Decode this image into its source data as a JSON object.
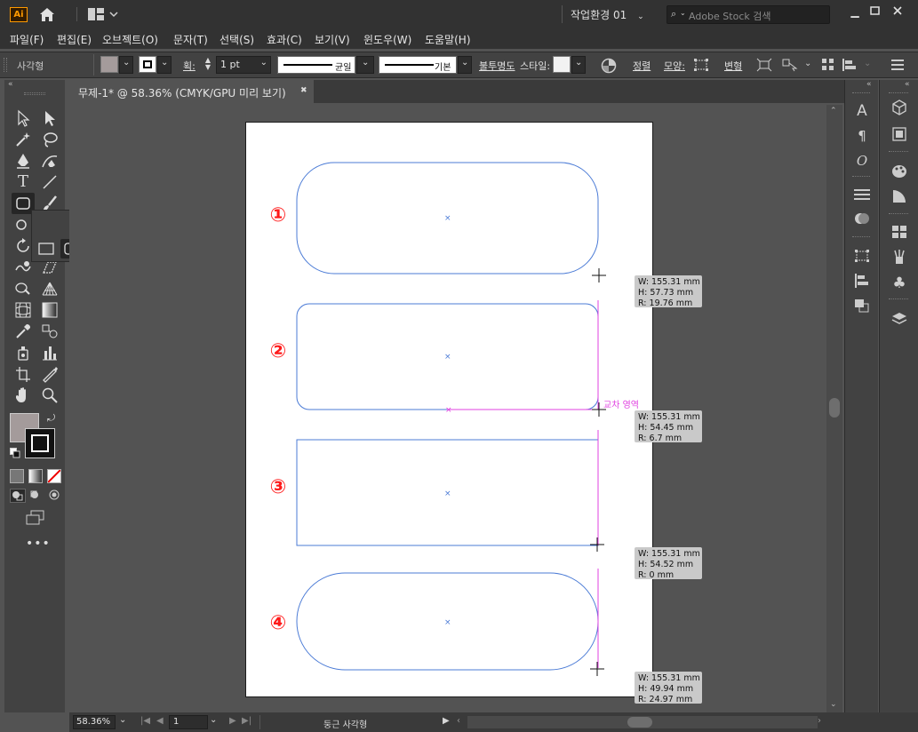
{
  "app": {
    "logo": "Ai",
    "workspace": "작업환경 01",
    "search_placeholder": "Adobe Stock 검색"
  },
  "menu": [
    "파일(F)",
    "편집(E)",
    "오브젝트(O)",
    "문자(T)",
    "선택(S)",
    "효과(C)",
    "보기(V)",
    "윈도우(W)",
    "도움말(H)"
  ],
  "control": {
    "object_type": "사각형",
    "stroke_label": "획:",
    "stroke_weight": "1 pt",
    "profile_label": "균일",
    "brush_label": "기본",
    "opacity_label": "불투명도",
    "style_label": "스타일:",
    "align_label": "정렬",
    "shape_label": "모양:",
    "transform_label": "변형"
  },
  "document": {
    "tab_title": "무제-1* @ 58.36% (CMYK/GPU 미리 보기)",
    "close_glyph": "✖"
  },
  "shapes": [
    {
      "number": "①",
      "w": "W: 155.31 mm",
      "h": "H: 57.73 mm",
      "r": "R: 19.76 mm"
    },
    {
      "number": "②",
      "w": "W: 155.31 mm",
      "h": "H: 54.45 mm",
      "r": "R: 6.7 mm"
    },
    {
      "number": "③",
      "w": "W: 155.31 mm",
      "h": "H: 54.52 mm",
      "r": "R: 0 mm"
    },
    {
      "number": "④",
      "w": "W: 155.31 mm",
      "h": "H: 49.94 mm",
      "r": "R: 24.97 mm"
    }
  ],
  "smart_guide_label": "교차 영역",
  "status": {
    "zoom": "58.36%",
    "artboard_number": "1",
    "tool_name": "둥근 사각형"
  },
  "colors": {
    "accent_path": "#4b7bd6",
    "smart_guide": "#e040e0",
    "annotation": "#ff1a1a",
    "fill_swatch": "#a49b9b"
  },
  "flyout": {
    "tools": [
      "rectangle-tool",
      "rounded-rectangle-tool",
      "ellipse-tool",
      "polygon-tool",
      "star-tool",
      "flare-tool"
    ]
  }
}
